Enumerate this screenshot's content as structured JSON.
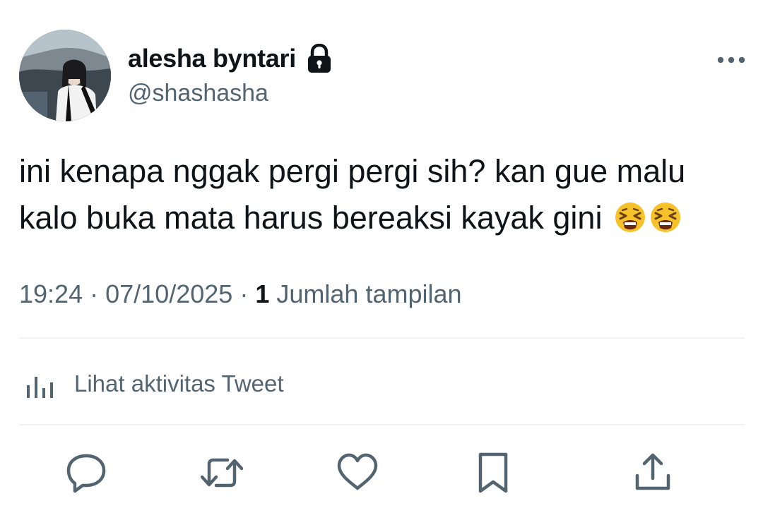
{
  "user": {
    "display_name": "alesha byntari",
    "handle": "@shashasha",
    "avatar_icon": "avatar-photo",
    "locked_icon": "lock-icon"
  },
  "tweet": {
    "line1": "ini kenapa nggak pergi pergi sih? kan gue malu",
    "line2": "kalo buka mata harus bereaksi kayak gini",
    "emojis": [
      "tired-face",
      "tired-face"
    ]
  },
  "meta": {
    "time": "19:24",
    "date": "07/10/2025",
    "sep": "·",
    "views_count": "1",
    "views_label": "Jumlah tampilan"
  },
  "activity": {
    "label": "Lihat aktivitas Tweet",
    "icon": "analytics-icon"
  },
  "actions": [
    {
      "icon": "reply-icon"
    },
    {
      "icon": "retweet-icon"
    },
    {
      "icon": "like-icon"
    },
    {
      "icon": "bookmark-icon"
    },
    {
      "icon": "share-icon"
    }
  ],
  "colors": {
    "text": "#0f1419",
    "muted": "#536471",
    "divider": "#eff3f4",
    "emoji_face": "#f6c22a"
  }
}
